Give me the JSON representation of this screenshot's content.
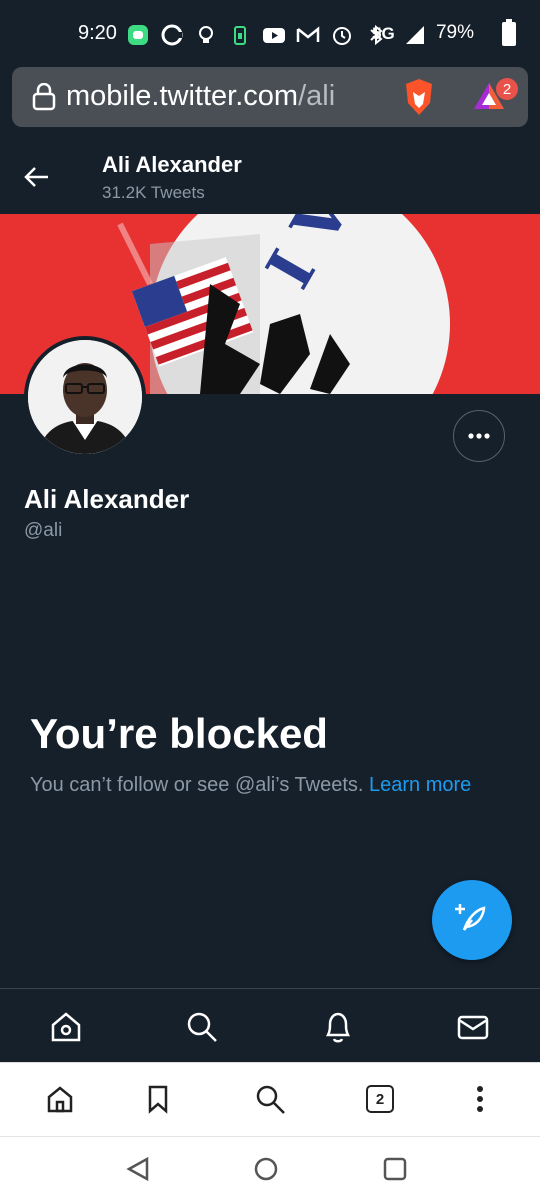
{
  "status_bar": {
    "time": "9:20",
    "network": "5G",
    "battery": "79%",
    "icons": [
      "chat-bubble-icon",
      "c-app-icon",
      "lightbulb-icon",
      "battery-saver-icon",
      "youtube-icon",
      "gmail-icon",
      "alarm-icon",
      "bluetooth-icon",
      "data-arrows-icon",
      "signal-icon",
      "battery-icon"
    ]
  },
  "browser": {
    "url_host": "mobile.twitter.com",
    "url_path": "/ali",
    "rewards_badge": "2",
    "tabs_count": "2"
  },
  "profile": {
    "header_name": "Ali Alexander",
    "tweet_count": "31.2K Tweets",
    "banner_text": "I Voted",
    "name": "Ali Alexander",
    "handle": "@ali"
  },
  "blocked": {
    "title": "You’re blocked",
    "message": "You can’t follow or see @ali’s Tweets.",
    "link": "Learn more"
  },
  "twitter_nav": {
    "items": [
      "home-icon",
      "search-icon",
      "notifications-icon",
      "messages-icon"
    ]
  },
  "colors": {
    "background": "#15202b",
    "accent": "#1d9bf0",
    "secondary_text": "#8b98a5",
    "banner_red": "#e83232"
  }
}
